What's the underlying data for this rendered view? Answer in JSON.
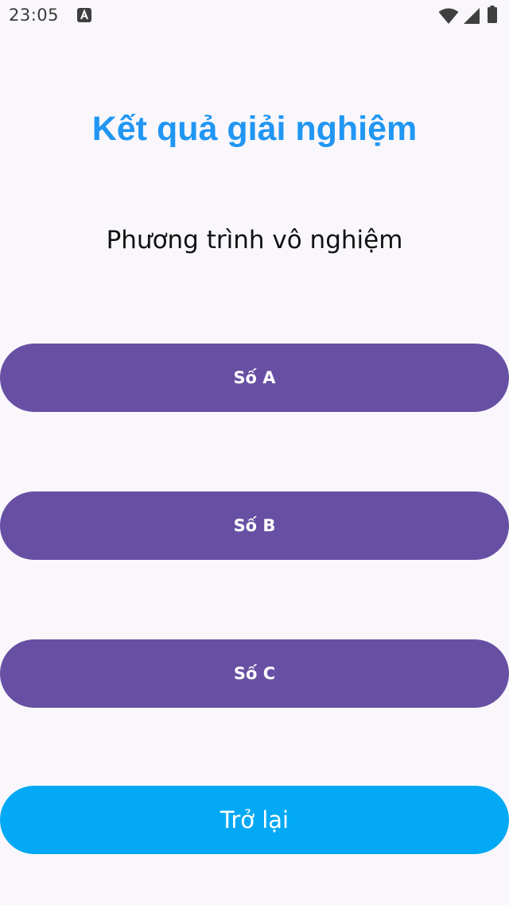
{
  "status_bar": {
    "time": "23:05",
    "icons": [
      "app-notification-icon",
      "wifi-icon",
      "signal-icon",
      "battery-icon"
    ]
  },
  "screen": {
    "title": "Kết quả giải nghiệm",
    "result": "Phương trình vô nghiệm"
  },
  "buttons": {
    "a_label": "Số A",
    "b_label": "Số B",
    "c_label": "Số C",
    "back_label": "Trở lại"
  },
  "colors": {
    "title": "#2196F3",
    "coefficient_button": "#6750A4",
    "back_button": "#03A9F4",
    "background": "#FAF7FC"
  }
}
